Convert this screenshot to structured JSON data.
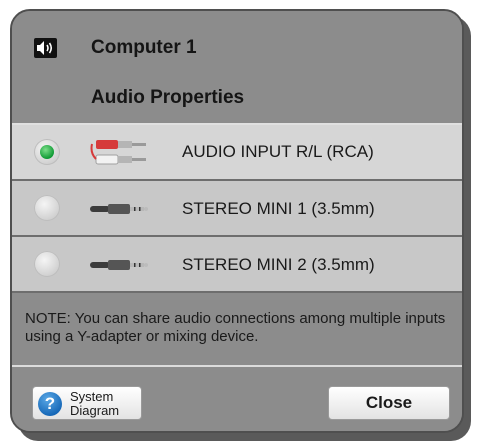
{
  "header": {
    "title": "Computer 1",
    "subtitle": "Audio Properties",
    "icon": "speaker-icon"
  },
  "inputs": [
    {
      "label": "AUDIO INPUT R/L (RCA)",
      "selected": true,
      "icon": "rca-connector-icon"
    },
    {
      "label": "STEREO MINI 1 (3.5mm)",
      "selected": false,
      "icon": "mini-jack-icon"
    },
    {
      "label": "STEREO MINI 2 (3.5mm)",
      "selected": false,
      "icon": "mini-jack-icon"
    }
  ],
  "note": "NOTE: You can share audio connections among multiple inputs using a Y-adapter or mixing device.",
  "footer": {
    "system_diagram_label": "System\nDiagram",
    "close_label": "Close",
    "help_icon": "question-icon"
  },
  "colors": {
    "panel": "#8d8d8d",
    "selected_row": "#d6d6d6",
    "row": "#c8c8c8",
    "radio_selected": "#1faa45",
    "help_icon": "#1466b6"
  }
}
